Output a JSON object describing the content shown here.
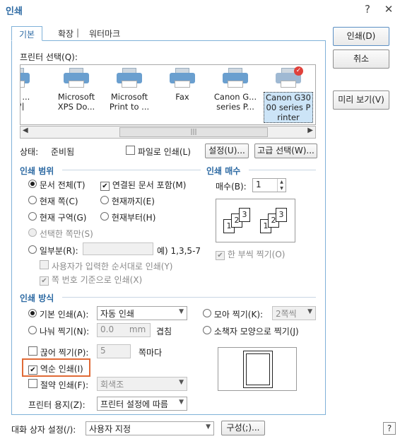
{
  "window": {
    "title": "인쇄",
    "help_btn": "?",
    "close_btn": "✕"
  },
  "tabs": [
    {
      "label": "기본"
    },
    {
      "label": "확장"
    },
    {
      "label": "워터마크"
    }
  ],
  "tab_separator": "|",
  "printer_select_label": "프린터 선택(Q):",
  "printers": [
    {
      "line1": "Jote ...",
      "line2": "내기"
    },
    {
      "line1": "Microsoft",
      "line2": "XPS Do..."
    },
    {
      "line1": "Microsoft",
      "line2": "Print to ..."
    },
    {
      "line1": "Fax",
      "line2": ""
    },
    {
      "line1": "Canon G...",
      "line2": "series P..."
    },
    {
      "line1": "Canon G30",
      "line2": "00 series P",
      "line3": "rinter"
    }
  ],
  "status": {
    "label": "상태:",
    "value": "준비됨"
  },
  "print_to_file": "파일로 인쇄(L)",
  "settings_btn": "설정(U)...",
  "advanced_btn": "고급 선택(W)...",
  "print_range": {
    "title": "인쇄 범위",
    "all": "문서 전체(T)",
    "linked": "연결된 문서 포함(M)",
    "current": "현재 쪽(C)",
    "to_current": "현재까지(E)",
    "current_section": "현재 구역(G)",
    "from_current": "현재부터(H)",
    "selected": "선택한 쪽만(S)",
    "partial": "일부분(R):",
    "partial_example": "예) 1,3,5-7",
    "user_order": "사용자가 입력한 순서대로 인쇄(Y)",
    "page_order": "쪽 번호 기준으로 인쇄(X)"
  },
  "copies": {
    "title": "인쇄 매수",
    "label": "매수(B):",
    "value": "1",
    "collate": "한 부씩 찍기(O)",
    "pages_a": [
      "1",
      "2",
      "3"
    ],
    "pages_b": [
      "1",
      "2",
      "3"
    ]
  },
  "print_method": {
    "title": "인쇄 방식",
    "basic": "기본 인쇄(A):",
    "basic_value": "자동 인쇄",
    "nup": "모아 찍기(K):",
    "nup_value": "2쪽씩",
    "split": "나눠 찍기(N):",
    "split_value": "0.0",
    "split_unit": "mm",
    "overlap": "겹침",
    "booklet": "소책자 모양으로 찍기(J)",
    "cut": "끊어 찍기(P):",
    "cut_value": "5",
    "cut_unit": "쪽마다",
    "proof": "역순 인쇄(I)",
    "saving": "절약 인쇄(F):",
    "saving_value": "회색조",
    "paper_label": "프린터 용지(Z):",
    "paper_value": "프린터 설정에 따름"
  },
  "buttons": {
    "print": "인쇄(D)",
    "cancel": "취소",
    "preview": "미리 보기(V)"
  },
  "footer": {
    "label": "대화 상자 설정(/):",
    "value": "사용자 지정",
    "config_btn": "구성(;)...",
    "help": "?"
  },
  "colors": {
    "accent": "#2d6aa3",
    "highlight": "#e06a36"
  }
}
